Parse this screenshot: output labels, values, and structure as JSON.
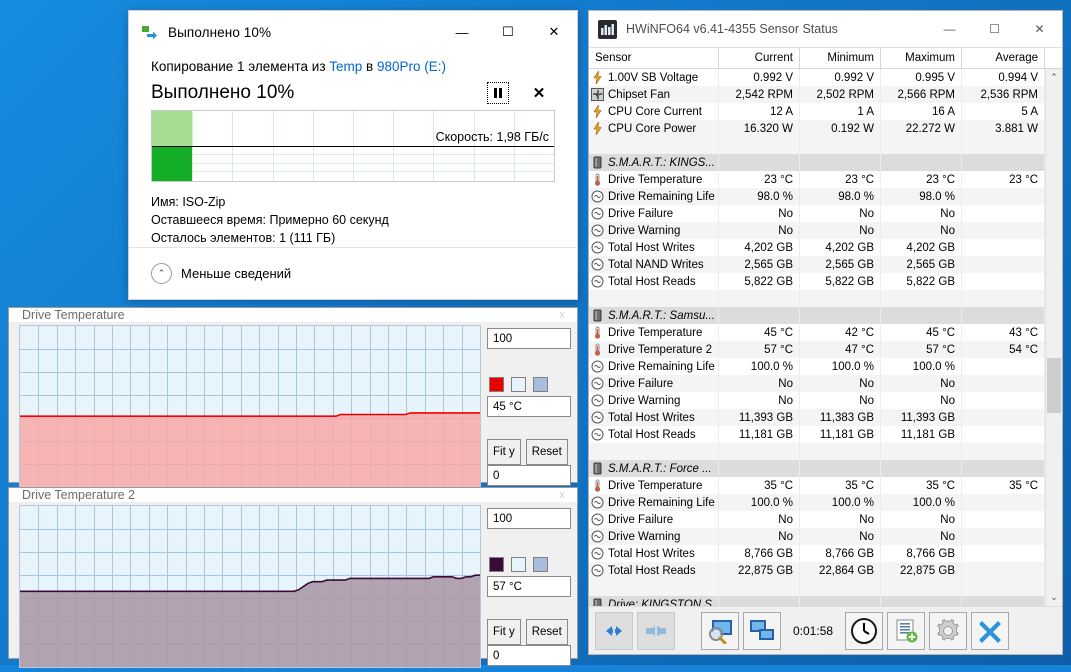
{
  "copy_dialog": {
    "title": "Выполнено 10%",
    "icon": "copy-files-icon",
    "minimize": "—",
    "maximize": "☐",
    "close": "✕",
    "operation_prefix": "Копирование 1 элемента из ",
    "source": "Temp",
    "operation_mid": " в ",
    "destination": "980Pro (E:)",
    "percent_label": "Выполнено 10%",
    "pause_button": "pause",
    "stop_button": "✕",
    "speed_label": "Скорость: 1,98 ГБ/c",
    "progress_percent": 10,
    "info": [
      {
        "key": "Имя:",
        "value": "ISO-Zip"
      },
      {
        "key": "Оставшееся время:",
        "value": "Примерно 60 секунд"
      },
      {
        "key": "Осталось элементов:",
        "value": "1 (111 ГБ)"
      }
    ],
    "footer_label": "Меньше сведений",
    "footer_chevron": "⌃"
  },
  "graph_windows": [
    {
      "title": "Drive Temperature",
      "close": "x",
      "max_label": "100",
      "min_label": "0",
      "current_label": "45 °C",
      "fit_label": "Fit y",
      "reset_label": "Reset",
      "swatches": [
        "#ee0000",
        "#e7f4fb",
        "#a8bcdd"
      ]
    },
    {
      "title": "Drive Temperature 2",
      "close": "x",
      "max_label": "100",
      "min_label": "0",
      "current_label": "57 °C",
      "fit_label": "Fit y",
      "reset_label": "Reset",
      "swatches": [
        "#3b0a38",
        "#e7f4fb",
        "#a8bcdd"
      ]
    }
  ],
  "chart_data": [
    {
      "type": "area",
      "title": "Drive Temperature",
      "ylabel": "°C",
      "ylim": [
        0,
        100
      ],
      "current": 45,
      "line_color": "#ee0000",
      "fill_color": "#f8a8a8",
      "grid": true,
      "values": [
        44,
        44,
        44,
        44,
        44,
        44,
        44,
        44,
        44,
        44,
        44,
        44,
        44,
        44,
        44,
        44,
        44,
        44,
        44,
        44,
        44,
        44,
        44,
        44,
        44,
        44,
        44,
        44,
        44,
        44,
        44,
        44,
        44,
        44,
        44,
        44,
        44,
        44,
        44,
        44,
        44,
        44,
        44,
        44,
        44,
        44,
        44,
        44,
        44,
        44,
        44,
        44,
        44,
        44,
        44,
        44,
        44,
        44,
        44,
        44,
        44,
        44,
        44,
        44,
        44,
        44,
        44,
        44,
        44,
        45,
        45,
        45,
        45,
        45,
        45,
        45,
        45,
        45,
        45,
        45,
        45,
        45,
        45,
        45,
        46,
        46,
        46,
        46,
        46,
        46,
        46,
        46,
        46,
        46,
        46,
        46,
        46,
        46,
        46,
        46
      ]
    },
    {
      "type": "area",
      "title": "Drive Temperature 2",
      "ylabel": "°C",
      "ylim": [
        0,
        100
      ],
      "current": 57,
      "line_color": "#3b0a38",
      "fill_color": "#a894a4",
      "grid": true,
      "values": [
        47,
        47,
        47,
        47,
        47,
        47,
        47,
        47,
        47,
        47,
        47,
        47,
        47,
        47,
        47,
        47,
        47,
        47,
        47,
        47,
        47,
        47,
        47,
        47,
        47,
        47,
        47,
        47,
        47,
        47,
        47,
        47,
        47,
        47,
        47,
        47,
        47,
        47,
        47,
        47,
        47,
        47,
        47,
        47,
        47,
        47,
        47,
        47,
        47,
        47,
        47,
        47,
        47,
        47,
        47,
        47,
        47,
        47,
        47,
        47,
        48,
        50,
        52,
        53,
        53,
        53,
        54,
        54,
        54,
        54,
        54,
        55,
        55,
        55,
        55,
        55,
        55,
        55,
        55,
        55,
        55,
        55,
        55,
        55,
        55,
        55,
        55,
        55,
        55,
        56,
        56,
        56,
        56,
        56,
        55,
        55,
        56,
        56,
        57,
        57
      ]
    }
  ],
  "hwinfo": {
    "title": "HWiNFO64 v6.41-4355 Sensor Status",
    "icon": "hwinfo-icon",
    "minimize": "—",
    "maximize": "☐",
    "close": "✕",
    "columns": [
      "Sensor",
      "Current",
      "Minimum",
      "Maximum",
      "Average"
    ],
    "scroll_up": "⌃",
    "scroll_down": "⌄",
    "rows": [
      {
        "kind": "data",
        "icon": "voltage-icon",
        "name": "1.00V SB Voltage",
        "current": "0.992 V",
        "minimum": "0.992 V",
        "maximum": "0.995 V",
        "average": "0.994 V"
      },
      {
        "kind": "data",
        "icon": "fan-icon",
        "name": "Chipset Fan",
        "current": "2,542 RPM",
        "minimum": "2,502 RPM",
        "maximum": "2,566 RPM",
        "average": "2,536 RPM"
      },
      {
        "kind": "data",
        "icon": "voltage-icon",
        "name": "CPU Core Current",
        "current": "12 A",
        "minimum": "1 A",
        "maximum": "16 A",
        "average": "5 A"
      },
      {
        "kind": "data",
        "icon": "voltage-icon",
        "name": "CPU Core Power",
        "current": "16.320 W",
        "minimum": "0.192 W",
        "maximum": "22.272 W",
        "average": "3.881 W"
      },
      {
        "kind": "blank"
      },
      {
        "kind": "group",
        "icon": "drive-icon",
        "name": "S.M.A.R.T.: KINGS..."
      },
      {
        "kind": "data",
        "icon": "thermometer-icon",
        "name": "Drive Temperature",
        "current": "23 °C",
        "minimum": "23 °C",
        "maximum": "23 °C",
        "average": "23 °C"
      },
      {
        "kind": "data",
        "icon": "gauge-icon",
        "name": "Drive Remaining Life",
        "current": "98.0 %",
        "minimum": "98.0 %",
        "maximum": "98.0 %",
        "average": ""
      },
      {
        "kind": "data",
        "icon": "gauge-icon",
        "name": "Drive Failure",
        "current": "No",
        "minimum": "No",
        "maximum": "No",
        "average": ""
      },
      {
        "kind": "data",
        "icon": "gauge-icon",
        "name": "Drive Warning",
        "current": "No",
        "minimum": "No",
        "maximum": "No",
        "average": ""
      },
      {
        "kind": "data",
        "icon": "gauge-icon",
        "name": "Total Host Writes",
        "current": "4,202 GB",
        "minimum": "4,202 GB",
        "maximum": "4,202 GB",
        "average": ""
      },
      {
        "kind": "data",
        "icon": "gauge-icon",
        "name": "Total NAND Writes",
        "current": "2,565 GB",
        "minimum": "2,565 GB",
        "maximum": "2,565 GB",
        "average": ""
      },
      {
        "kind": "data",
        "icon": "gauge-icon",
        "name": "Total Host Reads",
        "current": "5,822 GB",
        "minimum": "5,822 GB",
        "maximum": "5,822 GB",
        "average": ""
      },
      {
        "kind": "blank"
      },
      {
        "kind": "group",
        "icon": "drive-icon",
        "name": "S.M.A.R.T.: Samsu..."
      },
      {
        "kind": "data",
        "icon": "thermometer-icon",
        "name": "Drive Temperature",
        "current": "45 °C",
        "minimum": "42 °C",
        "maximum": "45 °C",
        "average": "43 °C"
      },
      {
        "kind": "data",
        "icon": "thermometer-icon",
        "name": "Drive Temperature 2",
        "current": "57 °C",
        "minimum": "47 °C",
        "maximum": "57 °C",
        "average": "54 °C"
      },
      {
        "kind": "data",
        "icon": "gauge-icon",
        "name": "Drive Remaining Life",
        "current": "100.0 %",
        "minimum": "100.0 %",
        "maximum": "100.0 %",
        "average": ""
      },
      {
        "kind": "data",
        "icon": "gauge-icon",
        "name": "Drive Failure",
        "current": "No",
        "minimum": "No",
        "maximum": "No",
        "average": ""
      },
      {
        "kind": "data",
        "icon": "gauge-icon",
        "name": "Drive Warning",
        "current": "No",
        "minimum": "No",
        "maximum": "No",
        "average": ""
      },
      {
        "kind": "data",
        "icon": "gauge-icon",
        "name": "Total Host Writes",
        "current": "11,393 GB",
        "minimum": "11,383 GB",
        "maximum": "11,393 GB",
        "average": ""
      },
      {
        "kind": "data",
        "icon": "gauge-icon",
        "name": "Total Host Reads",
        "current": "11,181 GB",
        "minimum": "11,181 GB",
        "maximum": "11,181 GB",
        "average": ""
      },
      {
        "kind": "blank"
      },
      {
        "kind": "group",
        "icon": "drive-icon",
        "name": "S.M.A.R.T.: Force ..."
      },
      {
        "kind": "data",
        "icon": "thermometer-icon",
        "name": "Drive Temperature",
        "current": "35 °C",
        "minimum": "35 °C",
        "maximum": "35 °C",
        "average": "35 °C"
      },
      {
        "kind": "data",
        "icon": "gauge-icon",
        "name": "Drive Remaining Life",
        "current": "100.0 %",
        "minimum": "100.0 %",
        "maximum": "100.0 %",
        "average": ""
      },
      {
        "kind": "data",
        "icon": "gauge-icon",
        "name": "Drive Failure",
        "current": "No",
        "minimum": "No",
        "maximum": "No",
        "average": ""
      },
      {
        "kind": "data",
        "icon": "gauge-icon",
        "name": "Drive Warning",
        "current": "No",
        "minimum": "No",
        "maximum": "No",
        "average": ""
      },
      {
        "kind": "data",
        "icon": "gauge-icon",
        "name": "Total Host Writes",
        "current": "8,766 GB",
        "minimum": "8,766 GB",
        "maximum": "8,766 GB",
        "average": ""
      },
      {
        "kind": "data",
        "icon": "gauge-icon",
        "name": "Total Host Reads",
        "current": "22,875 GB",
        "minimum": "22,864 GB",
        "maximum": "22,875 GB",
        "average": ""
      },
      {
        "kind": "blank"
      },
      {
        "kind": "group",
        "icon": "drive-icon",
        "name": "Drive: KINGSTON S..."
      }
    ],
    "toolbar": {
      "elapsed": "0:01:58",
      "buttons": [
        {
          "name": "expand-all-button",
          "icon": "arrows-out-icon"
        },
        {
          "name": "collapse-all-button",
          "icon": "arrows-in-icon"
        },
        {
          "name": "sensor-settings-button",
          "icon": "monitor-magnifier-icon"
        },
        {
          "name": "remote-monitor-button",
          "icon": "two-monitors-icon"
        },
        {
          "name": "reset-timer-button",
          "icon": "clock-icon"
        },
        {
          "name": "logging-button",
          "icon": "log-file-icon"
        },
        {
          "name": "configure-button",
          "icon": "gear-icon"
        },
        {
          "name": "close-button",
          "icon": "blue-x-icon"
        }
      ]
    }
  }
}
